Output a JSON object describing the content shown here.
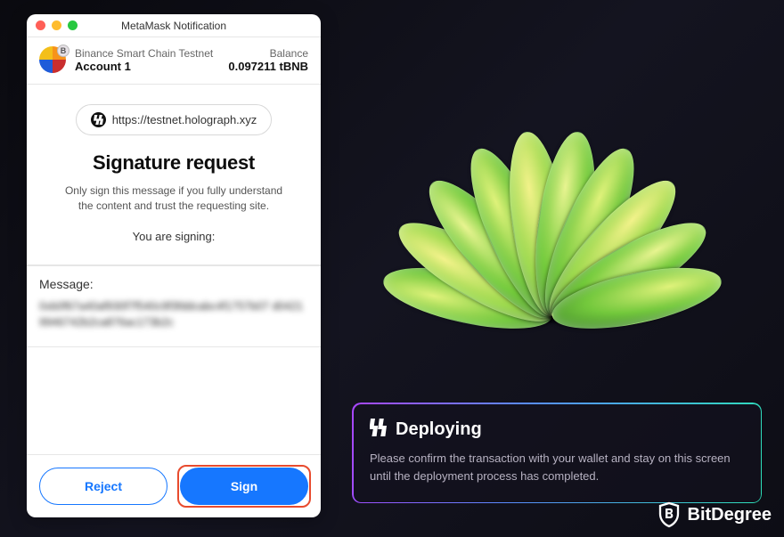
{
  "wallet": {
    "window_title": "MetaMask Notification",
    "network": "Binance Smart Chain Testnet",
    "account_name": "Account 1",
    "balance_label": "Balance",
    "balance_value": "0.097211 tBNB",
    "origin_url": "https://testnet.holograph.xyz",
    "signature_title": "Signature request",
    "signature_warning": "Only sign this message if you fully understand the content and trust the requesting site.",
    "signing_label": "You are signing:",
    "message_label": "Message:",
    "message_content": "0xb0f67a40af930f7f540c9f3fddcabc4f1757b07 d04219946742b2ca876ac173b2c",
    "reject_label": "Reject",
    "sign_label": "Sign"
  },
  "deploy_panel": {
    "title": "Deploying",
    "description": "Please confirm the transaction with your wallet and stay on this screen until the deployment process has completed."
  },
  "branding": {
    "name": "BitDegree"
  },
  "colors": {
    "accent_primary": "#1677ff",
    "highlight_border": "#e84b2e",
    "gradient_start": "#a946ff",
    "gradient_mid": "#5a8bff",
    "gradient_end": "#2de0b8"
  }
}
